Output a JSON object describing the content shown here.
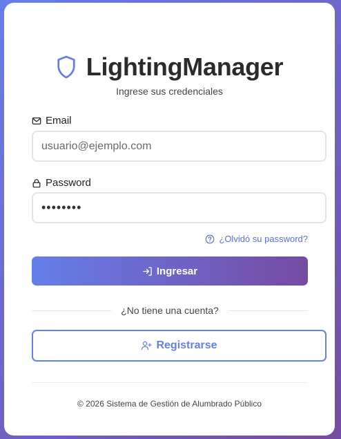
{
  "brand": {
    "title": "LightingManager",
    "subtitle": "Ingrese sus credenciales",
    "icon": "shield-icon",
    "accent_color": "#667eea",
    "accent_color_end": "#764ba2"
  },
  "form": {
    "email": {
      "label": "Email",
      "icon": "mail-icon",
      "placeholder": "usuario@ejemplo.com",
      "value": ""
    },
    "password": {
      "label": "Password",
      "icon": "lock-icon",
      "value": "••••••••"
    },
    "forgot_link": "¿Olvidó su password?",
    "submit_label": "Ingresar"
  },
  "register": {
    "prompt": "¿No tiene una cuenta?",
    "button_label": "Registrarse"
  },
  "footer": {
    "text": "© 2026 Sistema de Gestión de Alumbrado Público"
  }
}
